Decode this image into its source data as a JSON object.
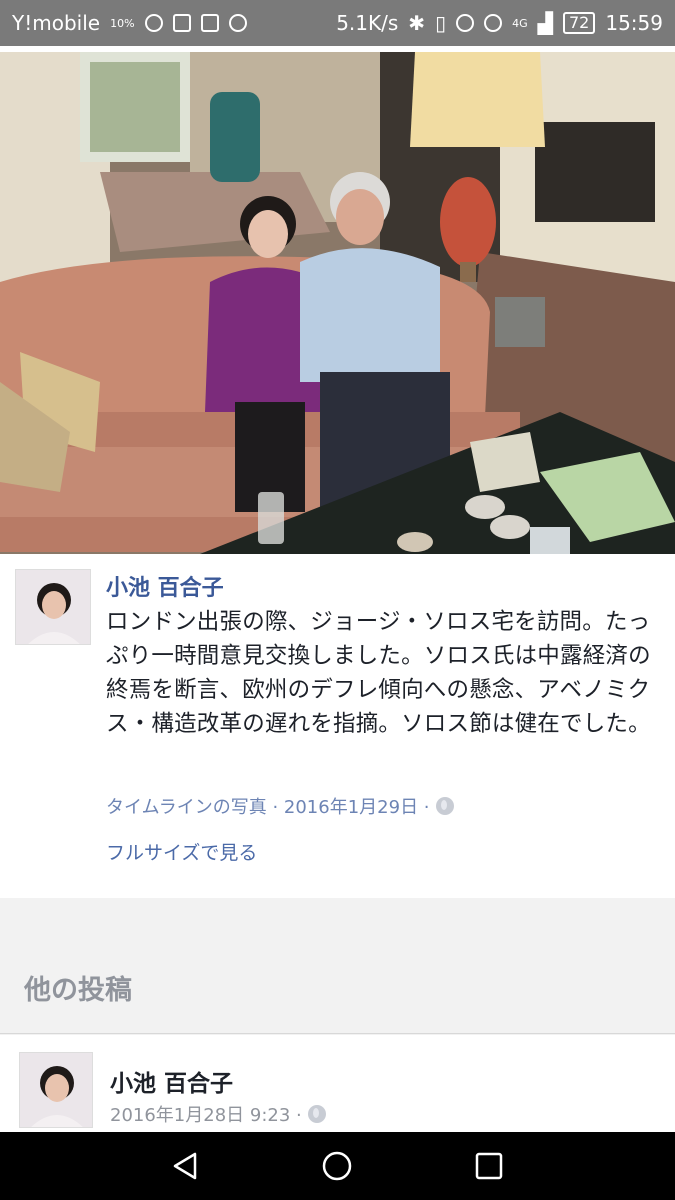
{
  "status_bar": {
    "carrier": "Y!mobile",
    "battery_saver": "10%",
    "speed": "5.1K/s",
    "network": "4G",
    "battery": "72",
    "time": "15:59"
  },
  "post": {
    "author": "小池 百合子",
    "text": "ロンドン出張の際、ジョージ・ソロス宅を訪問。たっぷり一時間意見交換しました。ソロス氏は中露経済の終焉を断言、欧州のデフレ傾向への懸念、アベノミクス・構造改革の遅れを指摘。ソロス節は健在でした。",
    "meta": "タイムラインの写真 · 2016年1月29日 ·",
    "full_size_link": "フルサイズで見る"
  },
  "other_posts": {
    "title": "他の投稿",
    "items": [
      {
        "author": "小池 百合子",
        "date": "2016年1月28日 9:23 ·"
      }
    ]
  },
  "icons": [
    "notification-icon",
    "chat-icon",
    "youtube-icon",
    "mail-icon",
    "app-icon",
    "bluetooth-icon",
    "vibrate-icon",
    "alarm-icon",
    "eye-icon",
    "signal-icon",
    "globe-icon",
    "back-icon",
    "home-icon",
    "recents-icon"
  ],
  "colors": {
    "link": "#3b5998",
    "meta": "#6d84b4",
    "statusbar": "#7a7a7a"
  }
}
